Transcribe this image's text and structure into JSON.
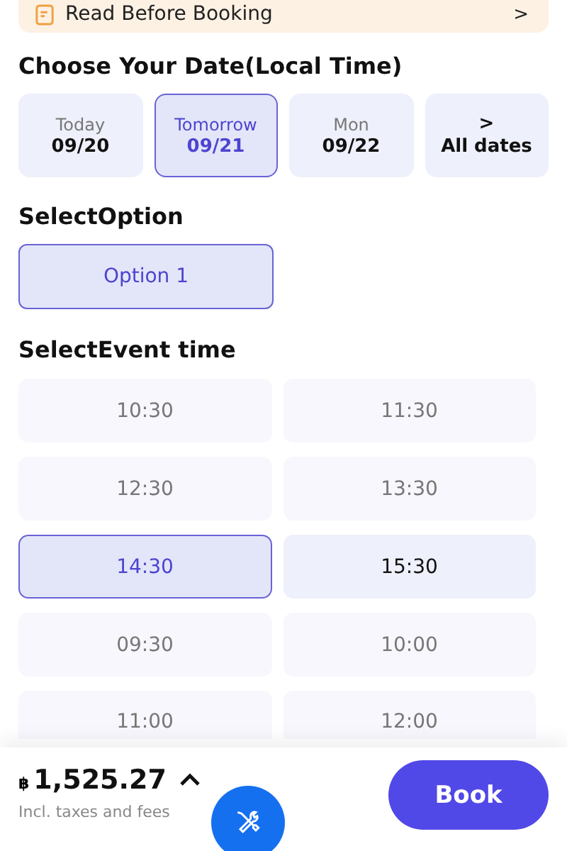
{
  "notice": {
    "label": "Read Before Booking",
    "arrow": ">"
  },
  "date_section": {
    "title": "Choose Your Date(Local Time)"
  },
  "dates": [
    {
      "kind": "day",
      "day": "Today",
      "date": "09/20",
      "selected": false
    },
    {
      "kind": "day",
      "day": "Tomorrow",
      "date": "09/21",
      "selected": true
    },
    {
      "kind": "day",
      "day": "Mon",
      "date": "09/22",
      "selected": false
    },
    {
      "kind": "more",
      "arrow": ">",
      "label": "All dates",
      "selected": false
    }
  ],
  "option_section": {
    "title": "SelectOption"
  },
  "options": [
    {
      "label": "Option 1",
      "selected": true
    }
  ],
  "time_section": {
    "title": "SelectEvent time"
  },
  "times": [
    {
      "label": "10:30",
      "selected": false,
      "highlighted": false
    },
    {
      "label": "11:30",
      "selected": false,
      "highlighted": false
    },
    {
      "label": "12:30",
      "selected": false,
      "highlighted": false
    },
    {
      "label": "13:30",
      "selected": false,
      "highlighted": false
    },
    {
      "label": "14:30",
      "selected": true,
      "highlighted": false
    },
    {
      "label": "15:30",
      "selected": false,
      "highlighted": true
    },
    {
      "label": "09:30",
      "selected": false,
      "highlighted": false
    },
    {
      "label": "10:00",
      "selected": false,
      "highlighted": false
    },
    {
      "label": "11:00",
      "selected": false,
      "highlighted": false
    },
    {
      "label": "12:00",
      "selected": false,
      "highlighted": false
    }
  ],
  "footer": {
    "currency": "฿",
    "price": "1,525.27",
    "note": "Incl. taxes and fees",
    "book": "Book"
  }
}
